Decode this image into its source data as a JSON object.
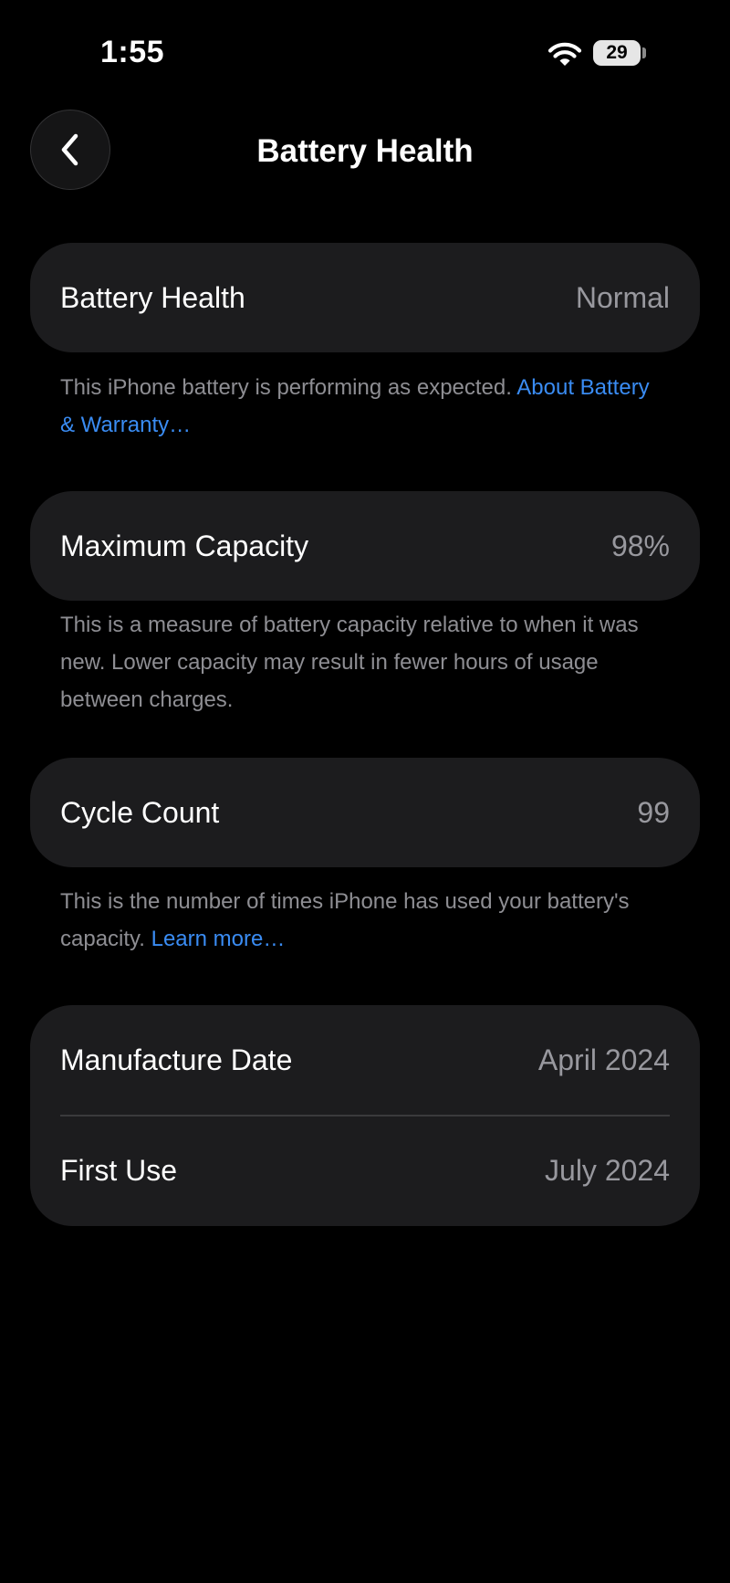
{
  "status_bar": {
    "time": "1:55",
    "battery_level": "29"
  },
  "nav": {
    "title": "Battery Health"
  },
  "battery_health": {
    "label": "Battery Health",
    "value": "Normal",
    "note": "This iPhone battery is performing as expected.",
    "link": "About Battery & Warranty…"
  },
  "maximum_capacity": {
    "label": "Maximum Capacity",
    "value": "98%",
    "note": "This is a measure of battery capacity relative to when it was new. Lower capacity may result in fewer hours of usage between charges."
  },
  "cycle_count": {
    "label": "Cycle Count",
    "value": "99",
    "note": "This is the number of times iPhone has used your battery's capacity.",
    "link": "Learn more…"
  },
  "dates": {
    "manufacture_label": "Manufacture Date",
    "manufacture_value": "April 2024",
    "first_use_label": "First Use",
    "first_use_value": "July 2024"
  },
  "colors": {
    "background": "#000000",
    "card": "#1c1c1e",
    "secondary_text": "#8e8e93",
    "link": "#3a8cf3"
  },
  "icons": {
    "back": "chevron-left-icon",
    "wifi": "wifi-icon",
    "battery": "battery-icon"
  }
}
